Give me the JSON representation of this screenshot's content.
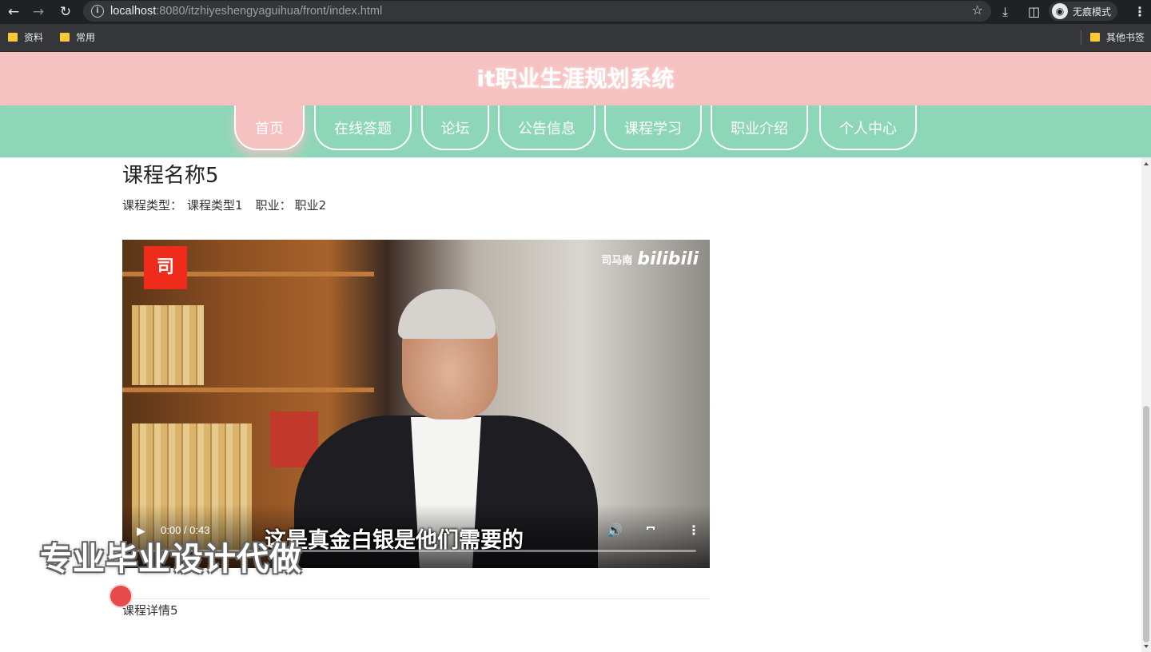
{
  "browser": {
    "url_host": "localhost",
    "url_rest": ":8080/itzhiyeshengyaguihua/front/index.html",
    "incognito_label": "无痕模式",
    "bookmarks": [
      {
        "label": "资料"
      },
      {
        "label": "常用"
      }
    ],
    "other_bookmarks": "其他书签"
  },
  "site": {
    "title": "it职业生涯规划系统"
  },
  "nav": {
    "items": [
      {
        "label": "首页",
        "active": true
      },
      {
        "label": "在线答题"
      },
      {
        "label": "论坛"
      },
      {
        "label": "公告信息"
      },
      {
        "label": "课程学习"
      },
      {
        "label": "职业介绍"
      },
      {
        "label": "个人中心"
      }
    ]
  },
  "course": {
    "name": "课程名称5",
    "type_label": "课程类型：",
    "type_value": "课程类型1",
    "job_label": "职业：",
    "job_value": "职业2",
    "detail": "课程详情5"
  },
  "video": {
    "logo_char": "司",
    "watermark_name": "司马南",
    "watermark_brand": "bilibili",
    "time": "0:00 / 0:43",
    "subtitle": "这是真金白银是他们需要的",
    "progress": 0
  },
  "overlay": {
    "text": "专业毕业设计代做"
  },
  "colors": {
    "header": "#f6c1c1",
    "nav": "#8dd7b8",
    "active_nav": "#f6c1c1"
  }
}
